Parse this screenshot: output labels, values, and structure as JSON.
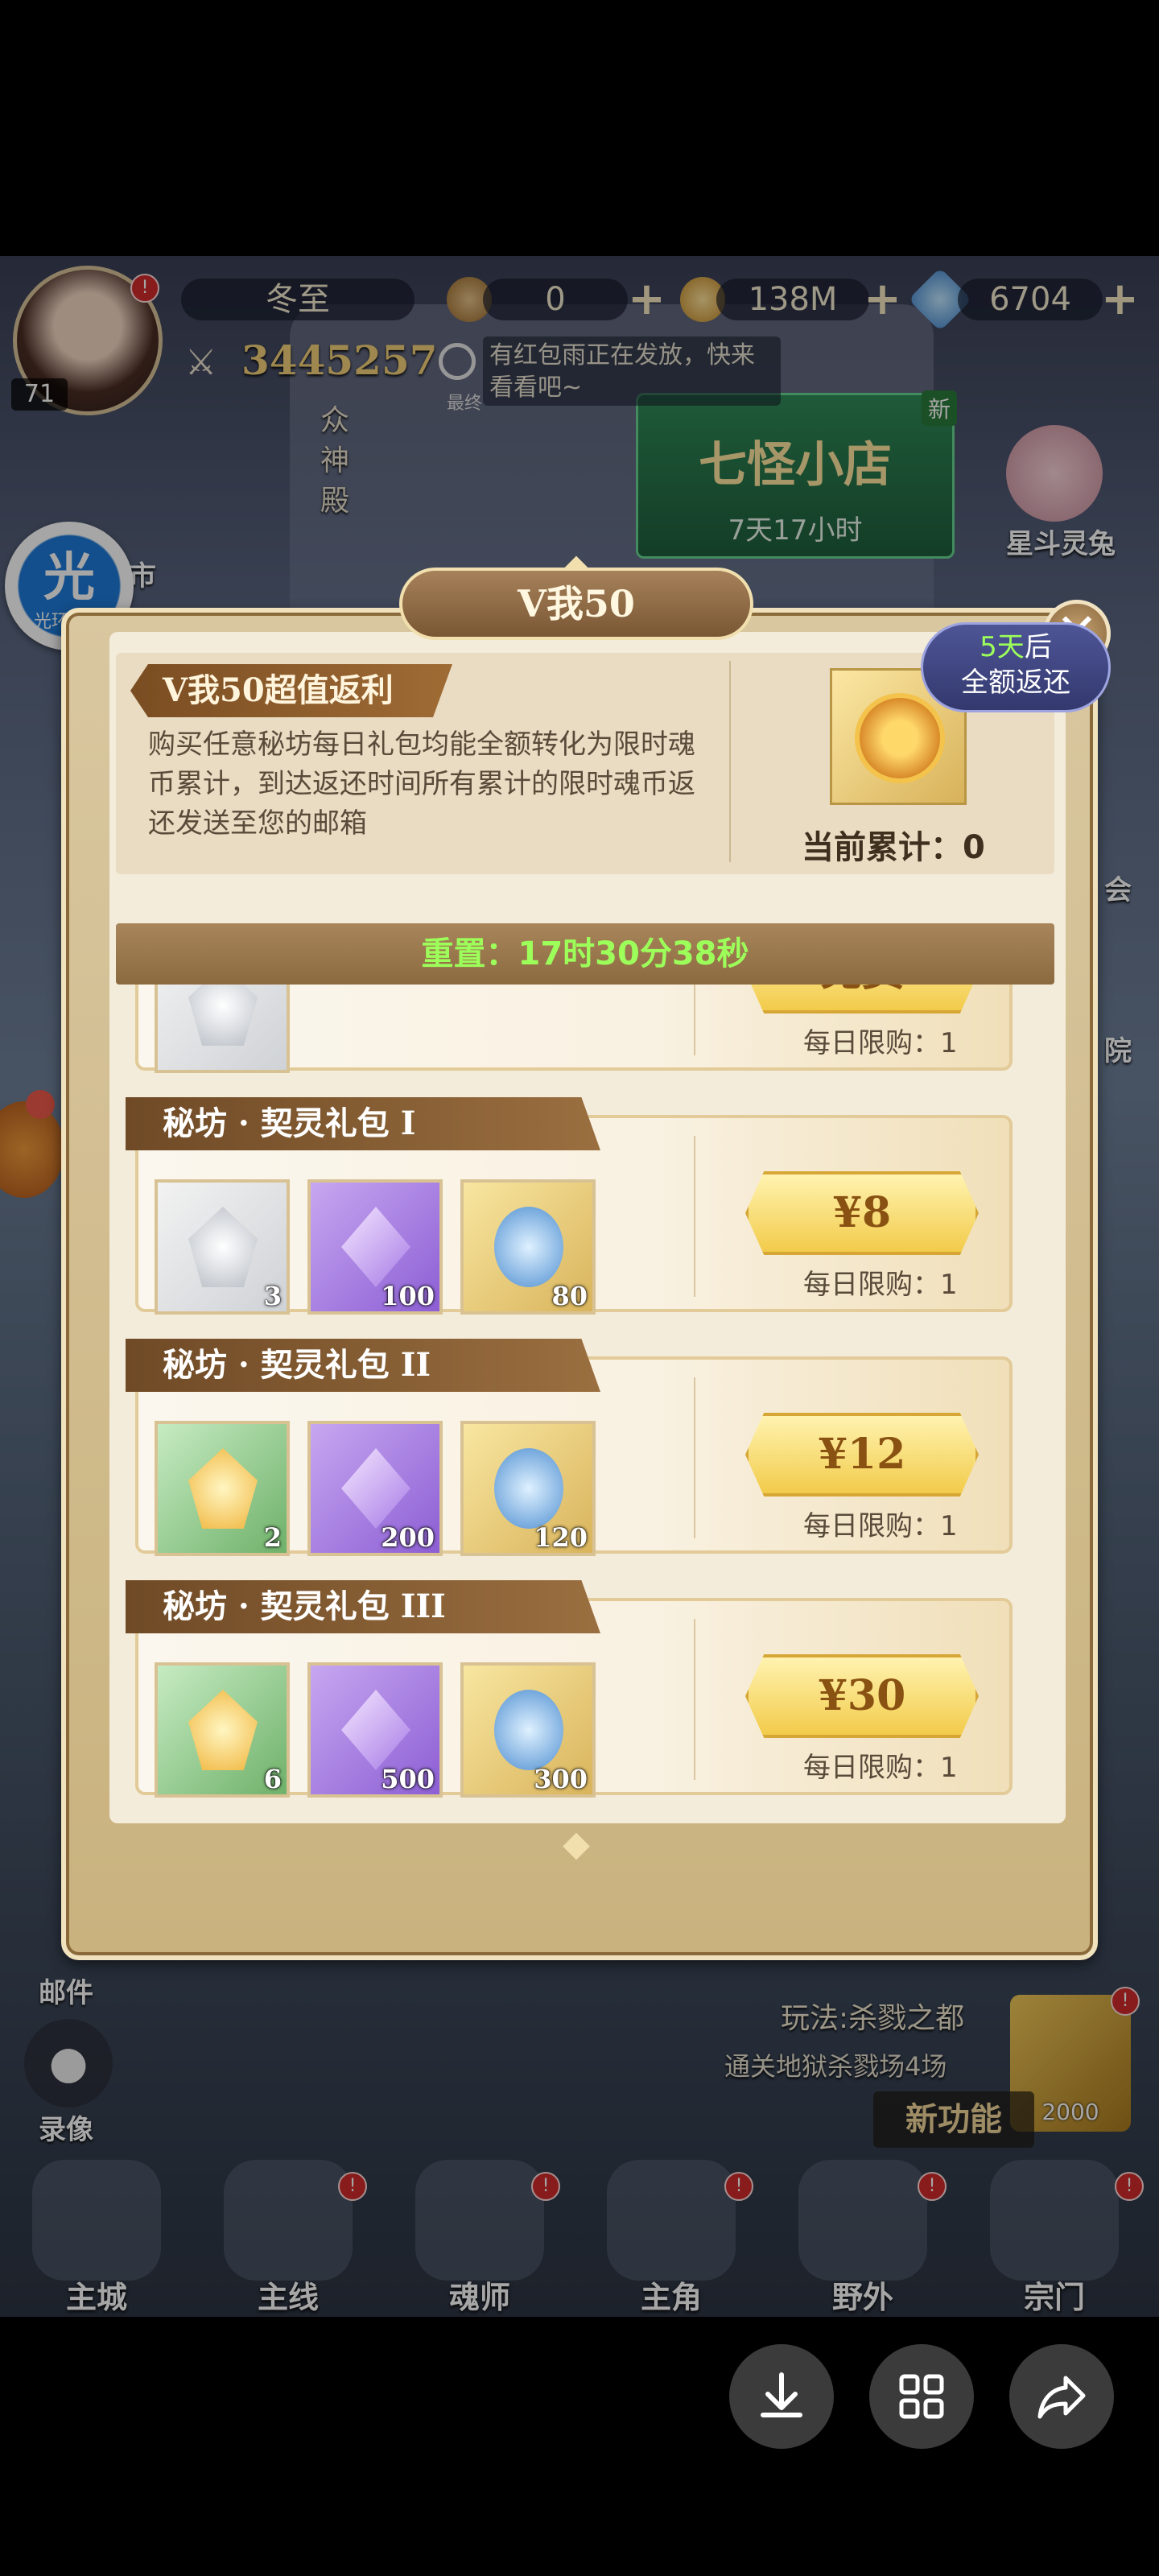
{
  "hud": {
    "player_name": "冬至",
    "level": "71",
    "power": "3445257",
    "currency1": "0",
    "currency2": "138M",
    "diamonds": "6704",
    "notice": "有红包雨正在发放，快来看看吧~",
    "notice_tag": "最终"
  },
  "background": {
    "left_labels": [
      "市",
      "邮件",
      "录像"
    ],
    "shop_title": "七怪小店",
    "shop_timer": "7天17小时",
    "shop_badge": "新",
    "npc_label": "星斗灵兔",
    "zone_label": "众神殿",
    "right_labels": [
      "会",
      "院"
    ],
    "quest_title": "玩法:杀戮之都",
    "quest_desc": "通关地狱杀戮场4场",
    "quest_reward": "2000",
    "new_feature": "新功能"
  },
  "assistant": {
    "label": "光环助手",
    "glyph": "光"
  },
  "bottom_nav": [
    {
      "label": "主城"
    },
    {
      "label": "主线"
    },
    {
      "label": "魂师"
    },
    {
      "label": "主角"
    },
    {
      "label": "野外"
    },
    {
      "label": "宗门"
    }
  ],
  "modal": {
    "title": "V我50",
    "close": "✕",
    "info_tag": "V我50超值返利",
    "info_desc": "购买任意秘坊每日礼包均能全额转化为限时魂币累计，到达返还时间所有累计的限时魂币返还发送至您的邮箱",
    "bubble_line1_a": "5天",
    "bubble_line1_b": "后",
    "bubble_line2": "全额返还",
    "accum_label": "当前累计：0",
    "reset": "重置：17时30分38秒"
  },
  "packs": [
    {
      "name": "",
      "price": "免费",
      "limit": "每日限购：1",
      "items": [
        {
          "kind": "grey",
          "qty": ""
        }
      ]
    },
    {
      "name": "秘坊 · 契灵礼包 I",
      "price": "¥8",
      "limit": "每日限购：1",
      "items": [
        {
          "kind": "grey",
          "qty": "3"
        },
        {
          "kind": "purple",
          "qty": "100"
        },
        {
          "kind": "gold",
          "qty": "80"
        }
      ]
    },
    {
      "name": "秘坊 · 契灵礼包 II",
      "price": "¥12",
      "limit": "每日限购：1",
      "items": [
        {
          "kind": "green",
          "qty": "2"
        },
        {
          "kind": "purple",
          "qty": "200"
        },
        {
          "kind": "gold",
          "qty": "120"
        }
      ]
    },
    {
      "name": "秘坊 · 契灵礼包 III",
      "price": "¥30",
      "limit": "每日限购：1",
      "items": [
        {
          "kind": "green",
          "qty": "6"
        },
        {
          "kind": "purple",
          "qty": "500"
        },
        {
          "kind": "gold",
          "qty": "300"
        }
      ]
    }
  ],
  "system_buttons": [
    {
      "icon": "download-icon"
    },
    {
      "icon": "grid-icon"
    },
    {
      "icon": "share-icon"
    }
  ],
  "colors": {
    "accent_green": "#9cff5a",
    "price_gold": "#f2cb4a",
    "tag_brown": "#7a4d22"
  }
}
